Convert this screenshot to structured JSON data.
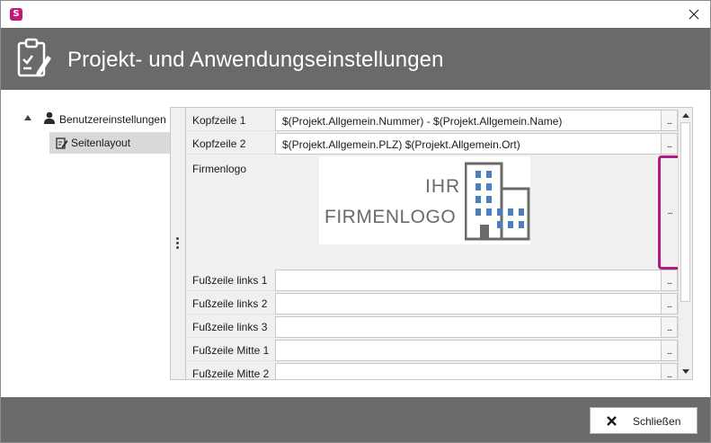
{
  "window": {
    "app_icon": "stadtsoftware-logo-icon",
    "close_icon": "close-icon",
    "title": "Projekt- und Anwendungseinstellungen",
    "header_icon": "clipboard-edit-icon",
    "header_bg": "#6a6a6a",
    "accent": "#b3197e"
  },
  "tree": {
    "root": {
      "label": "Benutzereinstellungen",
      "icon": "user-icon",
      "expanded": true
    },
    "children": [
      {
        "label": "Seitenlayout",
        "icon": "edit-document-icon",
        "selected": true
      }
    ]
  },
  "grid": {
    "rows": [
      {
        "label": "Kopfzeile 1",
        "value": "$(Projekt.Allgemein.Nummer) - $(Projekt.Allgemein.Name)",
        "button": "..."
      },
      {
        "label": "Kopfzeile 2",
        "value": "$(Projekt.Allgemein.PLZ) $(Projekt.Allgemein.Ort)",
        "button": "..."
      }
    ],
    "logo": {
      "label": "Firmenlogo",
      "line1": "IHR",
      "line2": "FIRMENLOGO",
      "icon": "building-icon",
      "button": "..."
    },
    "footer_rows": [
      {
        "label": "Fußzeile links 1",
        "value": "",
        "button": "..."
      },
      {
        "label": "Fußzeile links 2",
        "value": "",
        "button": "..."
      },
      {
        "label": "Fußzeile links 3",
        "value": "",
        "button": "..."
      },
      {
        "label": "Fußzeile Mitte 1",
        "value": "",
        "button": "..."
      },
      {
        "label": "Fußzeile Mitte 2",
        "value": "",
        "button": "..."
      }
    ]
  },
  "footer": {
    "close_label": "Schließen",
    "close_icon": "close-x-icon"
  }
}
